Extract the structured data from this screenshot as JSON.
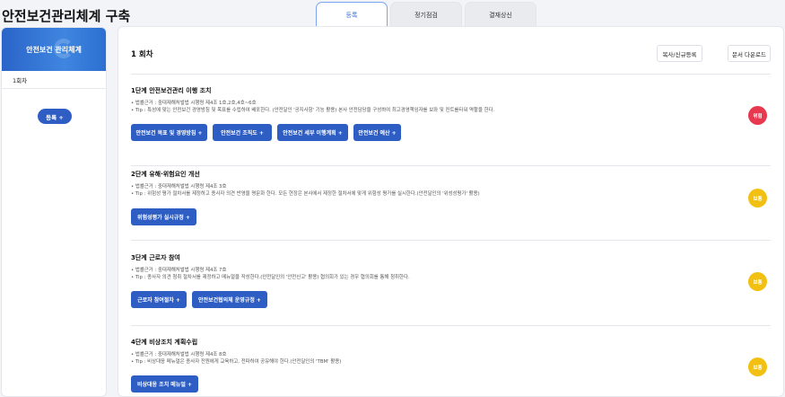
{
  "page_title": "안전보건관리체계 구축",
  "tabs": [
    {
      "label": "등록",
      "active": true
    },
    {
      "label": "정기점검",
      "active": false
    },
    {
      "label": "결재상신",
      "active": false
    }
  ],
  "sidebar": {
    "header": "안전보건 관리체계",
    "items": [
      {
        "label": "1회차"
      }
    ],
    "register_button": "등록 +"
  },
  "main": {
    "round_title": "1 회차",
    "copy_button": "복사/신규등록",
    "download_button": "문서 다운로드",
    "steps": [
      {
        "title": "1단계 안전보건관리 이행 조치",
        "basis": "• 법률근거 : 중대재해처벌법 시행령 제4조 1호,2호,4호~6호",
        "tip": "• Tip : 특성에 맞는 안전보건 경영방침 및 목표를 수립하여 배포한다. (안전달인 '공지사항' 기능 활용) 본사 안전담당을 구성하여 최고경영책임자를 보좌 및 컨트롤타워 역할을 한다.",
        "buttons": [
          "안전보건 목표 및 경영방침 +",
          "안전보건 조직도 +",
          "안전보건 세부 이행계획 +",
          "안전보건 예산 +"
        ],
        "status": "위험",
        "status_color": "#e8384f"
      },
      {
        "title": "2단계 유해·위험요인 개선",
        "basis": "• 법률근거 : 중대재해처벌법 시행령 제4조 3호",
        "tip": "• Tip : 위험성 평가 절차서를 제정하고 종사자 의견 반영을 명문화 한다. 모든 현장은 본사에서 제정한 절차서에 맞게 위험성 평가를 실시한다.(안전달인의 '위성성평가' 활용)",
        "buttons": [
          "위험성평가 실시규정 +"
        ],
        "status": "보통",
        "status_color": "#f2c010"
      },
      {
        "title": "3단계 근로자 참여",
        "basis": "• 법률근거 : 중대재해처벌법 시행령 제4조 7호",
        "tip": "• Tip : 종사자 의견 청취 절차서를 제정하고 메뉴얼을 작성한다.(안전달인의 '안전신고' 활용) 협의회가 있는 경우 협의회를 통해 청취한다.",
        "buttons": [
          "근로자 참여절차 +",
          "안전보건협의체 운영규정 +"
        ],
        "status": "보통",
        "status_color": "#f2c010"
      },
      {
        "title": "4단계 비상조치 계획수립",
        "basis": "• 법률근거 : 중대재해처벌법 시행령 제4조 8호",
        "tip": "• Tip : 비상대응 메뉴얼은 종사자 전원에게 교육하고, 전파하여 공유해야 한다.(안전달인의 'TBM' 활용)",
        "buttons": [
          "비상대응 조치 메뉴얼 +"
        ],
        "status": "보통",
        "status_color": "#f2c010"
      }
    ]
  }
}
